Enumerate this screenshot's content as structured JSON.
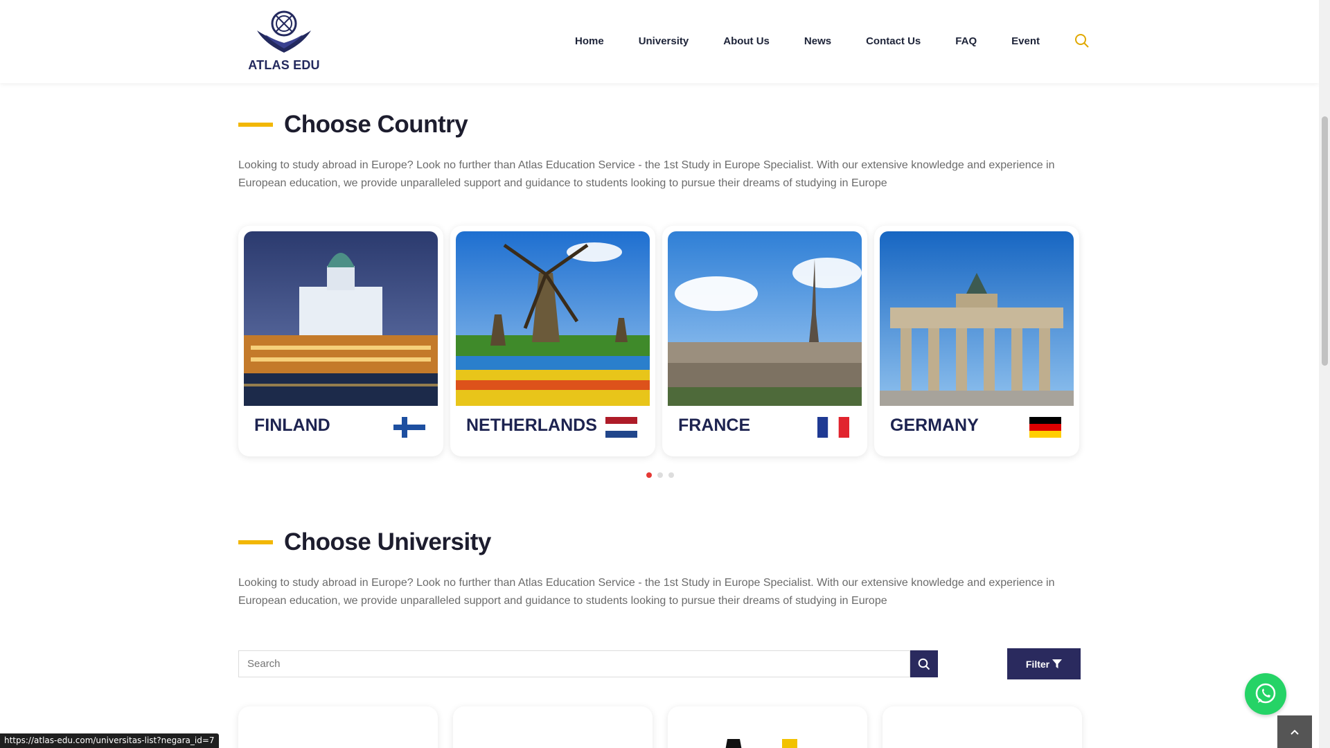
{
  "brand": {
    "name": "ATLAS EDU"
  },
  "nav": {
    "items": [
      {
        "label": "Home"
      },
      {
        "label": "University"
      },
      {
        "label": "About Us"
      },
      {
        "label": "News"
      },
      {
        "label": "Contact Us"
      },
      {
        "label": "FAQ"
      },
      {
        "label": "Event"
      }
    ],
    "search_icon": "search-icon"
  },
  "country_section": {
    "title": "Choose Country",
    "intro": "Looking to study abroad in Europe? Look no further than Atlas Education Service - the 1st Study in Europe Specialist. With our extensive knowledge and experience in European education, we provide unparalleled support and guidance to students looking to pursue their dreams of studying in Europe",
    "countries": [
      {
        "name": "FINLAND",
        "flag": "finland-flag"
      },
      {
        "name": "NETHERLANDS",
        "flag": "netherlands-flag"
      },
      {
        "name": "FRANCE",
        "flag": "france-flag"
      },
      {
        "name": "GERMANY",
        "flag": "germany-flag"
      }
    ],
    "carousel": {
      "pages": 3,
      "active": 1
    }
  },
  "university_section": {
    "title": "Choose University",
    "intro": "Looking to study abroad in Europe? Look no further than Atlas Education Service - the 1st Study in Europe Specialist. With our extensive knowledge and experience in European education, we provide unparalleled support and guidance to students looking to pursue their dreams of studying in Europe",
    "search": {
      "placeholder": "Search",
      "value": ""
    },
    "filter_label": "Filter"
  },
  "colors": {
    "accent": "#f2b705",
    "navy": "#2a2a5e",
    "whatsapp": "#25d366",
    "active_dot": "#e53935"
  },
  "status_bar": {
    "url": "https://atlas-edu.com/universitas-list?negara_id=7"
  }
}
